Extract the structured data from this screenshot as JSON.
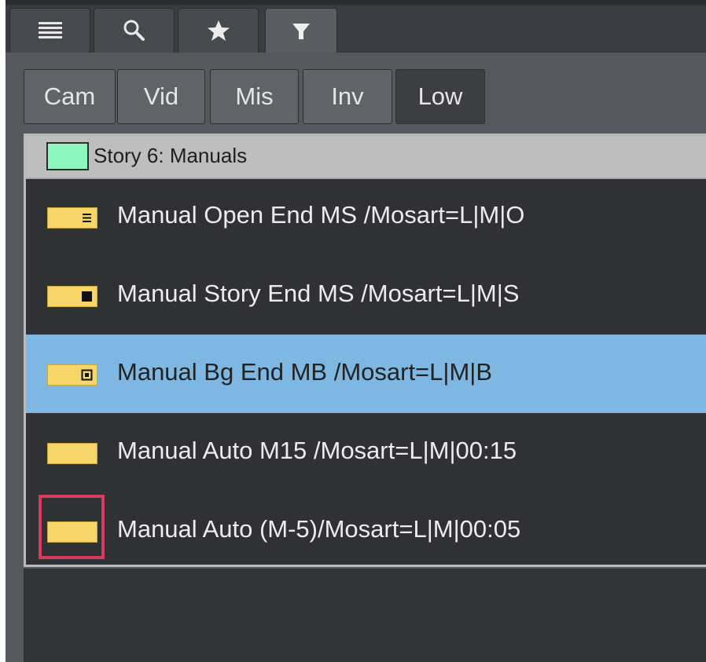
{
  "tabs": [
    {
      "icon": "list-icon",
      "active": false
    },
    {
      "icon": "search-icon",
      "active": false
    },
    {
      "icon": "star-icon",
      "active": false
    },
    {
      "icon": "filter-icon",
      "active": true
    }
  ],
  "filter_buttons": [
    {
      "label": "Cam",
      "active": false
    },
    {
      "label": "Vid",
      "active": false
    },
    {
      "label": "Mis",
      "active": false
    },
    {
      "label": "Inv",
      "active": false
    },
    {
      "label": "Low",
      "active": true
    }
  ],
  "story": {
    "title": "Story 6: Manuals",
    "color": "#8EF7BF"
  },
  "items": [
    {
      "label": "Manual Open End MS /Mosart=L|M|O",
      "end_icon": "open-end-icon",
      "selected": false
    },
    {
      "label": "Manual Story End MS /Mosart=L|M|S",
      "end_icon": "story-end-icon",
      "selected": false
    },
    {
      "label": "Manual Bg End MB /Mosart=L|M|B",
      "end_icon": "bg-end-icon",
      "selected": true
    },
    {
      "label": "Manual Auto M15 /Mosart=L|M|00:15",
      "end_icon": "auto-icon",
      "selected": false
    },
    {
      "label": "Manual Auto (M-5)/Mosart=L|M|00:05",
      "end_icon": "auto-icon",
      "selected": false
    }
  ],
  "colors": {
    "chip": "#F7D76A",
    "selection": "#7FB7E3",
    "highlight": "#D43D5E"
  }
}
